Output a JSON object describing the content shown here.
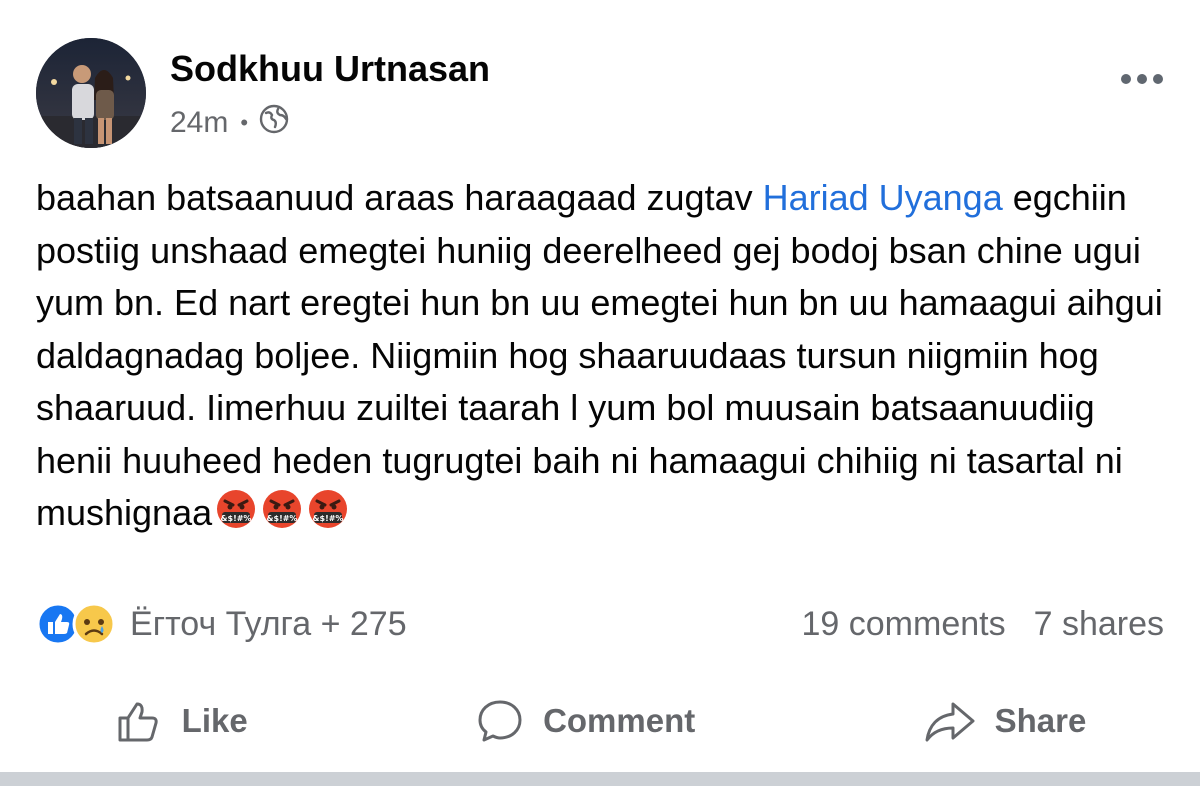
{
  "post": {
    "author": "Sodkhuu Urtnasan",
    "time": "24m",
    "privacy_icon": "globe-icon",
    "menu_icon": "more-options-icon",
    "body": {
      "text_before_mention": "baahan batsaanuud araas haraagaad zugtav ",
      "mention": "Hariad Uyanga",
      "text_after_mention": " egchiin postiig unshaad emegtei huniig deerelheed gej bodoj bsan chine ugui yum bn. Ed nart eregtei hun bn uu emegtei hun bn uu hamaagui aihgui daldagnadag boljee. Niigmiin hog shaaruudaas tursun niigmiin hog shaaruud. Iimerhuu zuiltei taarah l yum bol muusain batsaanuudiig henii huuheed heden tugrugtei baih ni hamaagui chihiig ni tasartal ni mushignaa",
      "emojis": [
        "face-with-symbols-on-mouth",
        "face-with-symbols-on-mouth",
        "face-with-symbols-on-mouth"
      ]
    }
  },
  "reactions": {
    "icons": [
      "like-icon",
      "sad-icon"
    ],
    "summary": "Ёгточ Тулга + 275",
    "comments": "19 comments",
    "shares": "7 shares"
  },
  "actions": {
    "like": "Like",
    "comment": "Comment",
    "share": "Share"
  },
  "colors": {
    "link": "#216fdb",
    "secondary_text": "#65676b",
    "like_blue": "#1877f2",
    "emoji_red": "#e8452c"
  }
}
